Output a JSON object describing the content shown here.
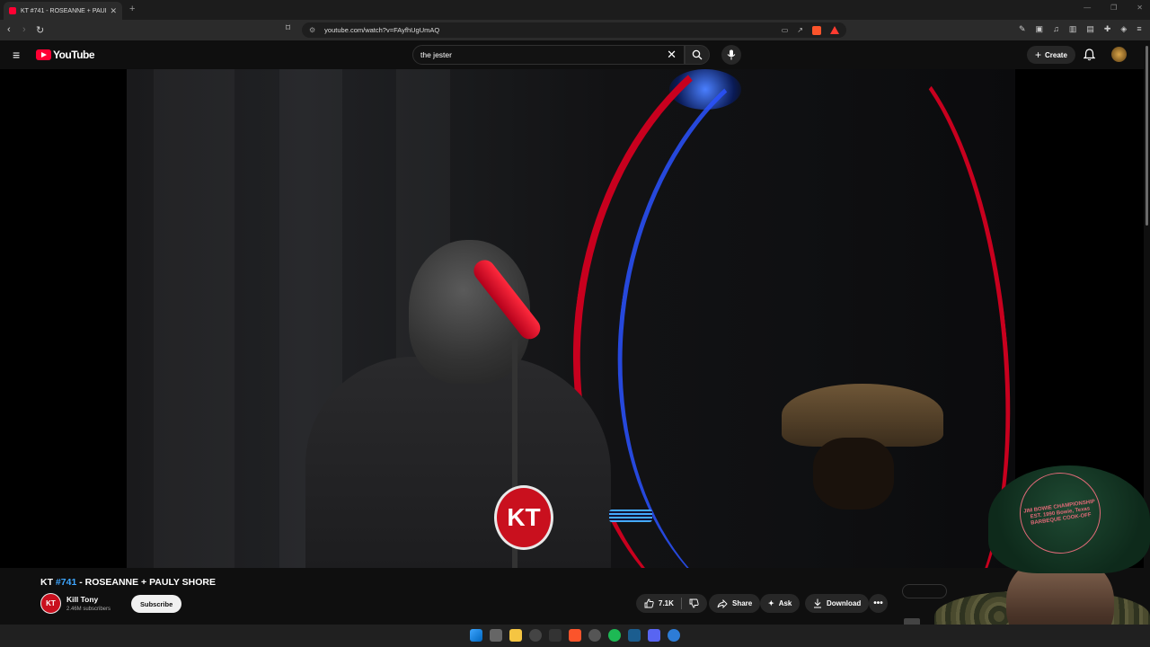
{
  "browser": {
    "tab_title": "KT #741 - ROSEANNE + PAULY SHORE",
    "url": "youtube.com/watch?v=FAyfhUgUmAQ"
  },
  "youtube": {
    "logo_text": "YouTube",
    "search_value": "the jester",
    "create_label": "Create"
  },
  "video": {
    "title_prefix": "KT ",
    "title_hash": "#741",
    "title_suffix": " - ROSEANNE + PAULY SHORE",
    "channel_name": "Kill Tony",
    "channel_initials": "KT",
    "subscribers": "2.46M subscribers",
    "subscribe_label": "Subscribe",
    "likes": "7.1K",
    "share_label": "Share",
    "ask_label": "Ask",
    "download_label": "Download",
    "kt_logo_text": "KT"
  },
  "webcam": {
    "cap_patch_text": "JIM BOWIE CHAMPIONSHIP EST. 1990 Bowie, Texas BARBEQUE COOK-OFF"
  },
  "colors": {
    "youtube_red": "#ff0033",
    "link_blue": "#3ea6ff",
    "kt_red": "#c9101e"
  }
}
